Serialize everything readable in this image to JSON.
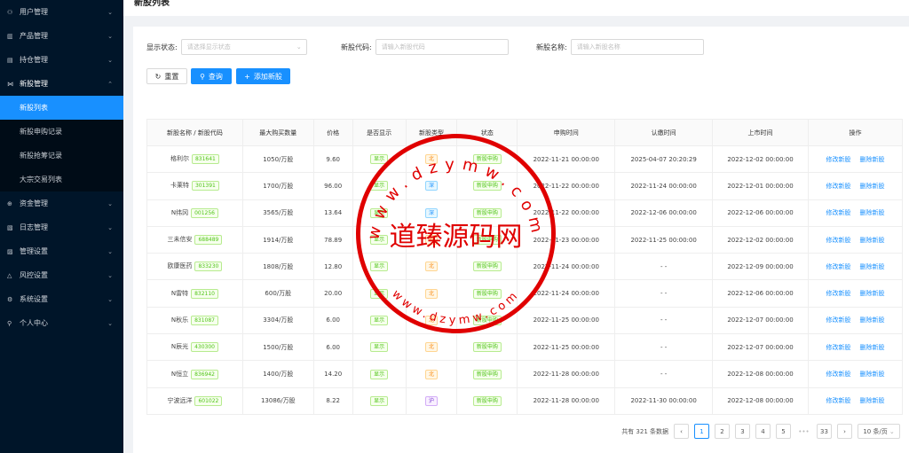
{
  "sidebar": {
    "items": [
      {
        "label": "用户管理",
        "icon": "users-icon",
        "glyph": "⚇",
        "chev": "⌄"
      },
      {
        "label": "产品管理",
        "icon": "product-icon",
        "glyph": "▥",
        "chev": "⌄"
      },
      {
        "label": "持仓管理",
        "icon": "holdings-icon",
        "glyph": "▤",
        "chev": "⌄"
      },
      {
        "label": "新股管理",
        "icon": "ipo-icon",
        "glyph": "⋈",
        "chev": "⌃",
        "open": true
      },
      {
        "label": "资金管理",
        "icon": "funds-icon",
        "glyph": "⊕",
        "chev": "⌄"
      },
      {
        "label": "日志管理",
        "icon": "log-icon",
        "glyph": "▧",
        "chev": "⌄"
      },
      {
        "label": "管理设置",
        "icon": "admin-settings-icon",
        "glyph": "▨",
        "chev": "⌄"
      },
      {
        "label": "风控设置",
        "icon": "risk-icon",
        "glyph": "△",
        "chev": "⌄"
      },
      {
        "label": "系统设置",
        "icon": "gear-icon",
        "glyph": "⚙",
        "chev": "⌄"
      },
      {
        "label": "个人中心",
        "icon": "user-icon",
        "glyph": "⚲",
        "chev": "⌄"
      }
    ],
    "subitems": [
      "新股列表",
      "新股申购记录",
      "新股抢筹记录",
      "大宗交易列表"
    ]
  },
  "page": {
    "title": "新股列表"
  },
  "filters": {
    "status_label": "显示状态:",
    "status_placeholder": "请选择显示状态",
    "code_label": "新股代码:",
    "code_placeholder": "请输入新股代码",
    "name_label": "新股名称:",
    "name_placeholder": "请输入新股名称"
  },
  "buttons": {
    "reset": "重置",
    "query": "查询",
    "add": "添加新股",
    "reset_icon": "↻",
    "query_icon": "⚲",
    "add_icon": "+"
  },
  "table": {
    "headers": [
      "新股名称 / 新股代码",
      "最大购买数量",
      "价格",
      "是否显示",
      "新股类型",
      "状态",
      "申购时间",
      "认缴时间",
      "上市时间",
      "操作"
    ],
    "edit_label": "修改新股",
    "delete_label": "删除新股",
    "rows": [
      {
        "name": "格利尔",
        "code": "831641",
        "qty": "1050/万股",
        "price": "9.60",
        "show": "显示",
        "type": "北",
        "status": "新股申购",
        "apply": "2022-11-21 00:00:00",
        "sub": "2025-04-07 20:20:29",
        "list": "2022-12-02 00:00:00"
      },
      {
        "name": "卡莱特",
        "code": "301391",
        "qty": "1700/万股",
        "price": "96.00",
        "show": "显示",
        "type": "深",
        "status": "新股申购",
        "apply": "2022-11-22 00:00:00",
        "sub": "2022-11-24 00:00:00",
        "list": "2022-12-01 00:00:00"
      },
      {
        "name": "N纬冈",
        "code": "001256",
        "qty": "3565/万股",
        "price": "13.64",
        "show": "显示",
        "type": "深",
        "status": "新股申购",
        "apply": "2022-11-22 00:00:00",
        "sub": "2022-12-06 00:00:00",
        "list": "2022-12-06 00:00:00"
      },
      {
        "name": "三未信安",
        "code": "688489",
        "qty": "1914/万股",
        "price": "78.89",
        "show": "显示",
        "type": "科",
        "status": "新股申购",
        "apply": "2022-11-23 00:00:00",
        "sub": "2022-11-25 00:00:00",
        "list": "2022-12-02 00:00:00"
      },
      {
        "name": "欧康医药",
        "code": "833230",
        "qty": "1808/万股",
        "price": "12.80",
        "show": "显示",
        "type": "北",
        "status": "新股申购",
        "apply": "2022-11-24 00:00:00",
        "sub": "- -",
        "list": "2022-12-09 00:00:00"
      },
      {
        "name": "N雷特",
        "code": "832110",
        "qty": "600/万股",
        "price": "20.00",
        "show": "显示",
        "type": "北",
        "status": "新股申购",
        "apply": "2022-11-24 00:00:00",
        "sub": "- -",
        "list": "2022-12-06 00:00:00"
      },
      {
        "name": "N秋乐",
        "code": "831087",
        "qty": "3304/万股",
        "price": "6.00",
        "show": "显示",
        "type": "北",
        "status": "新股申购",
        "apply": "2022-11-25 00:00:00",
        "sub": "- -",
        "list": "2022-12-07 00:00:00"
      },
      {
        "name": "N辰光",
        "code": "430300",
        "qty": "1500/万股",
        "price": "6.00",
        "show": "显示",
        "type": "北",
        "status": "新股申购",
        "apply": "2022-11-25 00:00:00",
        "sub": "- -",
        "list": "2022-12-07 00:00:00"
      },
      {
        "name": "N恒立",
        "code": "836942",
        "qty": "1400/万股",
        "price": "14.20",
        "show": "显示",
        "type": "北",
        "status": "新股申购",
        "apply": "2022-11-28 00:00:00",
        "sub": "- -",
        "list": "2022-12-08 00:00:00"
      },
      {
        "name": "宁波远洋",
        "code": "601022",
        "qty": "13086/万股",
        "price": "8.22",
        "show": "显示",
        "type": "沪",
        "status": "新股申购",
        "apply": "2022-11-28 00:00:00",
        "sub": "2022-11-30 00:00:00",
        "list": "2022-12-08 00:00:00"
      }
    ]
  },
  "pagination": {
    "total": "共有 321 条数据",
    "prev": "‹",
    "pages": [
      "1",
      "2",
      "3",
      "4",
      "5"
    ],
    "ellipsis": "•••",
    "last": "33",
    "next": "›",
    "size": "10 条/页"
  },
  "watermark": {
    "cn": "道臻源码网",
    "top_url": "www.dzymw.com",
    "bottom_url": "www.dzymw.com"
  },
  "colors": {
    "sidebar": "#001529",
    "accent": "#1890ff",
    "tag_green": "#52c41a",
    "watermark": "#e00000"
  }
}
